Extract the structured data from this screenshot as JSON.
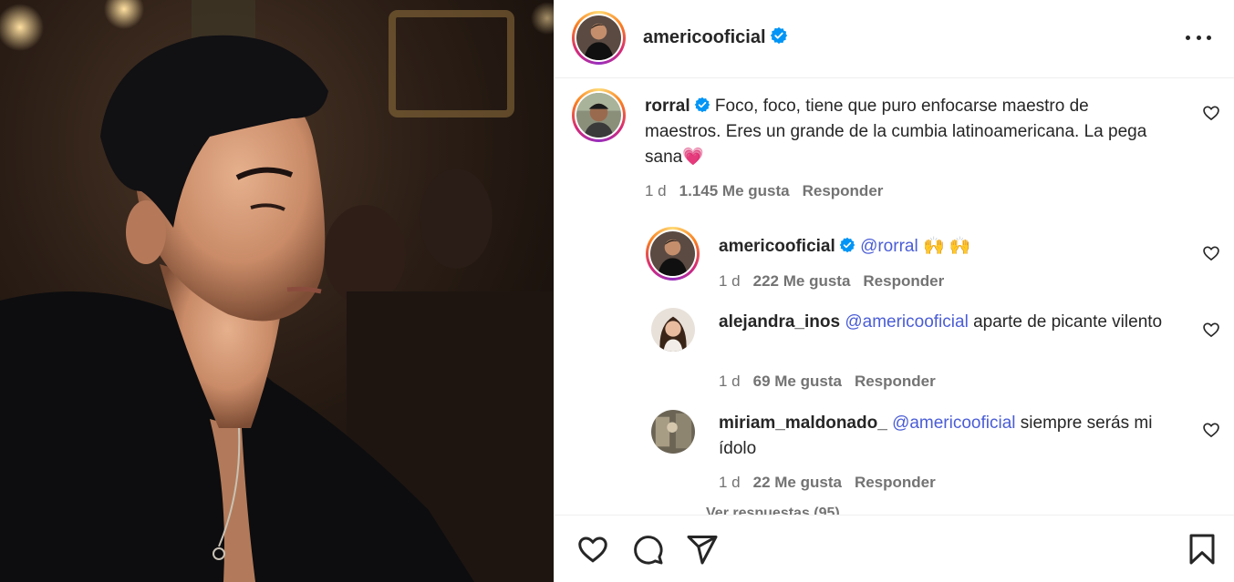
{
  "post": {
    "author": "americooficial",
    "more_label": "Más opciones"
  },
  "comments": [
    {
      "user": "rorral",
      "text": "Foco, foco, tiene que puro enfocarse maestro de maestros. Eres un grande de la cumbia latinoamericana. La pega sana",
      "emoji": "💗",
      "time": "1 d",
      "likes": "1.145 Me gusta",
      "reply": "Responder"
    },
    {
      "user": "americooficial",
      "mention": "@rorral",
      "text": " 🙌 🙌",
      "time": "1 d",
      "likes": "222 Me gusta",
      "reply": "Responder"
    },
    {
      "user": "alejandra_inos",
      "mention": "@americooficial",
      "text": " aparte de picante vilento",
      "time": "1 d",
      "likes": "69 Me gusta",
      "reply": "Responder"
    },
    {
      "user": "miriam_maldonado_",
      "mention": "@americooficial",
      "text": " siempre serás mi ídolo",
      "time": "1 d",
      "likes": "22 Me gusta",
      "reply": "Responder"
    }
  ],
  "view_replies": "Ver respuestas (95)",
  "icons": {
    "like": "heart-icon",
    "comment": "comment-icon",
    "share": "share-icon",
    "save": "bookmark-icon",
    "verified": "verified-badge-icon",
    "more": "more-dots-icon"
  },
  "colors": {
    "verified": "#0095f6",
    "mention": "#4a5dd6",
    "meta": "#737373"
  }
}
